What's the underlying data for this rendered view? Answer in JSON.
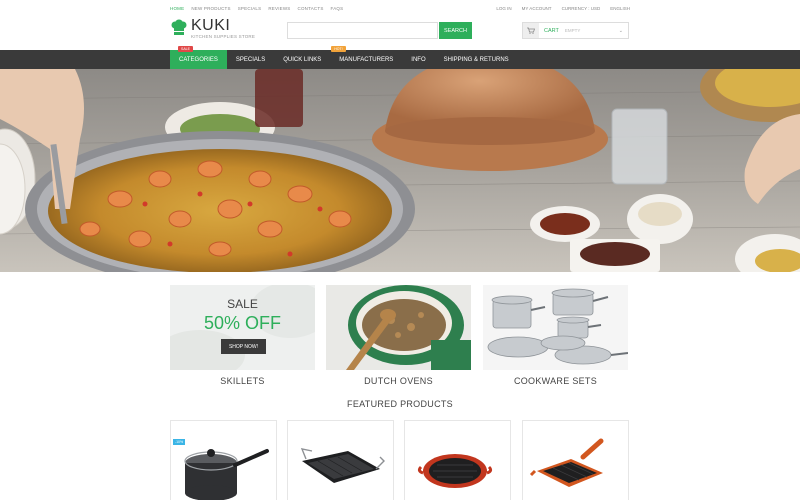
{
  "top_nav": {
    "links": [
      "HOME",
      "NEW PRODUCTS",
      "SPECIALS",
      "REVIEWS",
      "CONTACTS",
      "FAQS"
    ],
    "right": [
      "LOG IN",
      "MY ACCOUNT",
      "CURRENCY : USD",
      "ENGLISH"
    ]
  },
  "logo": {
    "name": "KUKI",
    "tagline": "KITCHEN SUPPLIES STORE"
  },
  "search": {
    "placeholder": "",
    "button": "SEARCH"
  },
  "cart": {
    "label": "CART",
    "status": "EMPTY"
  },
  "main_nav": {
    "items": [
      {
        "label": "CATEGORIES",
        "badge": "SALE"
      },
      {
        "label": "SPECIALS"
      },
      {
        "label": "QUICK LINKS"
      },
      {
        "label": "MANUFACTURERS",
        "badge": "HOT!"
      },
      {
        "label": "INFO"
      },
      {
        "label": "SHIPPING & RETURNS"
      }
    ]
  },
  "promo": {
    "sale": "SALE",
    "percent": "50% OFF",
    "button": "SHOP NOW!"
  },
  "categories": [
    "SKILLETS",
    "DUTCH OVENS",
    "COOKWARE SETS"
  ],
  "featured": {
    "title": "FEATURED PRODUCTS",
    "badge": "-10%",
    "products": [
      "saucepan",
      "griddle",
      "grill-pan-round",
      "grill-pan-square"
    ]
  },
  "colors": {
    "accent": "#2eaf5b",
    "nav_bg": "#3a3a3a",
    "sale_badge": "#e04848",
    "hot_badge": "#f2a33a",
    "discount_badge": "#3ab5e6"
  }
}
